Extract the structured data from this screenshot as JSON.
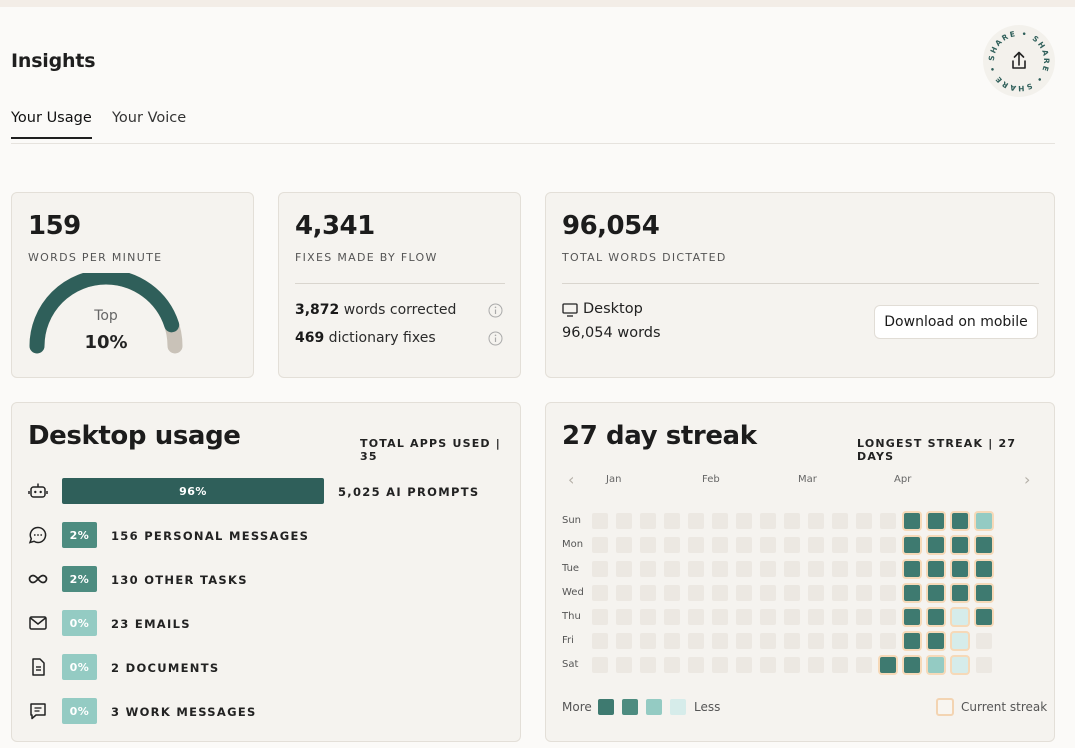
{
  "page": {
    "title": "Insights"
  },
  "share": {
    "ring_text": "SHARE • SHARE • SHARE • "
  },
  "tabs": [
    {
      "label": "Your Usage",
      "active": true
    },
    {
      "label": "Your Voice",
      "active": false
    }
  ],
  "wpm": {
    "value": "159",
    "caption": "WORDS PER MINUTE",
    "gauge_top": "Top",
    "gauge_pct": "10%",
    "gauge_fraction": 0.9
  },
  "fixes": {
    "value": "4,341",
    "caption": "FIXES MADE BY FLOW",
    "line1_num": "3,872",
    "line1_text": " words corrected",
    "line2_num": "469",
    "line2_text": " dictionary fixes"
  },
  "dictated": {
    "value": "96,054",
    "caption": "TOTAL WORDS DICTATED",
    "device": "Desktop",
    "device_words": "96,054 words",
    "download_label": "Download on mobile"
  },
  "desktop_usage": {
    "title": "Desktop usage",
    "meta": "TOTAL APPS USED | 35",
    "rows": [
      {
        "icon": "robot-icon",
        "pct": "96%",
        "fraction": 0.96,
        "label": "5,025 AI PROMPTS"
      },
      {
        "icon": "chat-bubble-icon",
        "pct": "2%",
        "fraction": 0.02,
        "label": "156 PERSONAL MESSAGES"
      },
      {
        "icon": "infinity-icon",
        "pct": "2%",
        "fraction": 0.02,
        "label": "130 OTHER TASKS"
      },
      {
        "icon": "mail-icon",
        "pct": "0%",
        "fraction": 0.0,
        "label": "23 EMAILS"
      },
      {
        "icon": "document-icon",
        "pct": "0%",
        "fraction": 0.0,
        "label": "2 DOCUMENTS"
      },
      {
        "icon": "work-message-icon",
        "pct": "0%",
        "fraction": 0.0,
        "label": "3 WORK MESSAGES"
      }
    ]
  },
  "streak": {
    "title": "27 day streak",
    "meta": "LONGEST STREAK | 27 DAYS",
    "months": [
      "Jan",
      "Feb",
      "Mar",
      "Apr"
    ],
    "days": [
      "Sun",
      "Mon",
      "Tue",
      "Wed",
      "Thu",
      "Fri",
      "Sat"
    ],
    "grid": [
      [
        0,
        0,
        0,
        0,
        0,
        0,
        0,
        0,
        0,
        0,
        0,
        0,
        0,
        4,
        4,
        4,
        2
      ],
      [
        0,
        0,
        0,
        0,
        0,
        0,
        0,
        0,
        0,
        0,
        0,
        0,
        0,
        4,
        4,
        4,
        4
      ],
      [
        0,
        0,
        0,
        0,
        0,
        0,
        0,
        0,
        0,
        0,
        0,
        0,
        0,
        4,
        4,
        4,
        4
      ],
      [
        0,
        0,
        0,
        0,
        0,
        0,
        0,
        0,
        0,
        0,
        0,
        0,
        0,
        4,
        4,
        4,
        4
      ],
      [
        0,
        0,
        0,
        0,
        0,
        0,
        0,
        0,
        0,
        0,
        0,
        0,
        0,
        4,
        4,
        1,
        4
      ],
      [
        0,
        0,
        0,
        0,
        0,
        0,
        0,
        0,
        0,
        0,
        0,
        0,
        0,
        4,
        4,
        1,
        0
      ],
      [
        0,
        0,
        0,
        0,
        0,
        0,
        0,
        0,
        0,
        0,
        0,
        0,
        4,
        4,
        2,
        1,
        0
      ]
    ],
    "legend_more": "More",
    "legend_less": "Less",
    "current_streak_label": "Current streak"
  },
  "colors": {
    "accent": "#2f5f5a",
    "teal_mid": "#4d8c80",
    "teal_light": "#94cbc3",
    "gauge_gray": "#c9c2b8"
  }
}
